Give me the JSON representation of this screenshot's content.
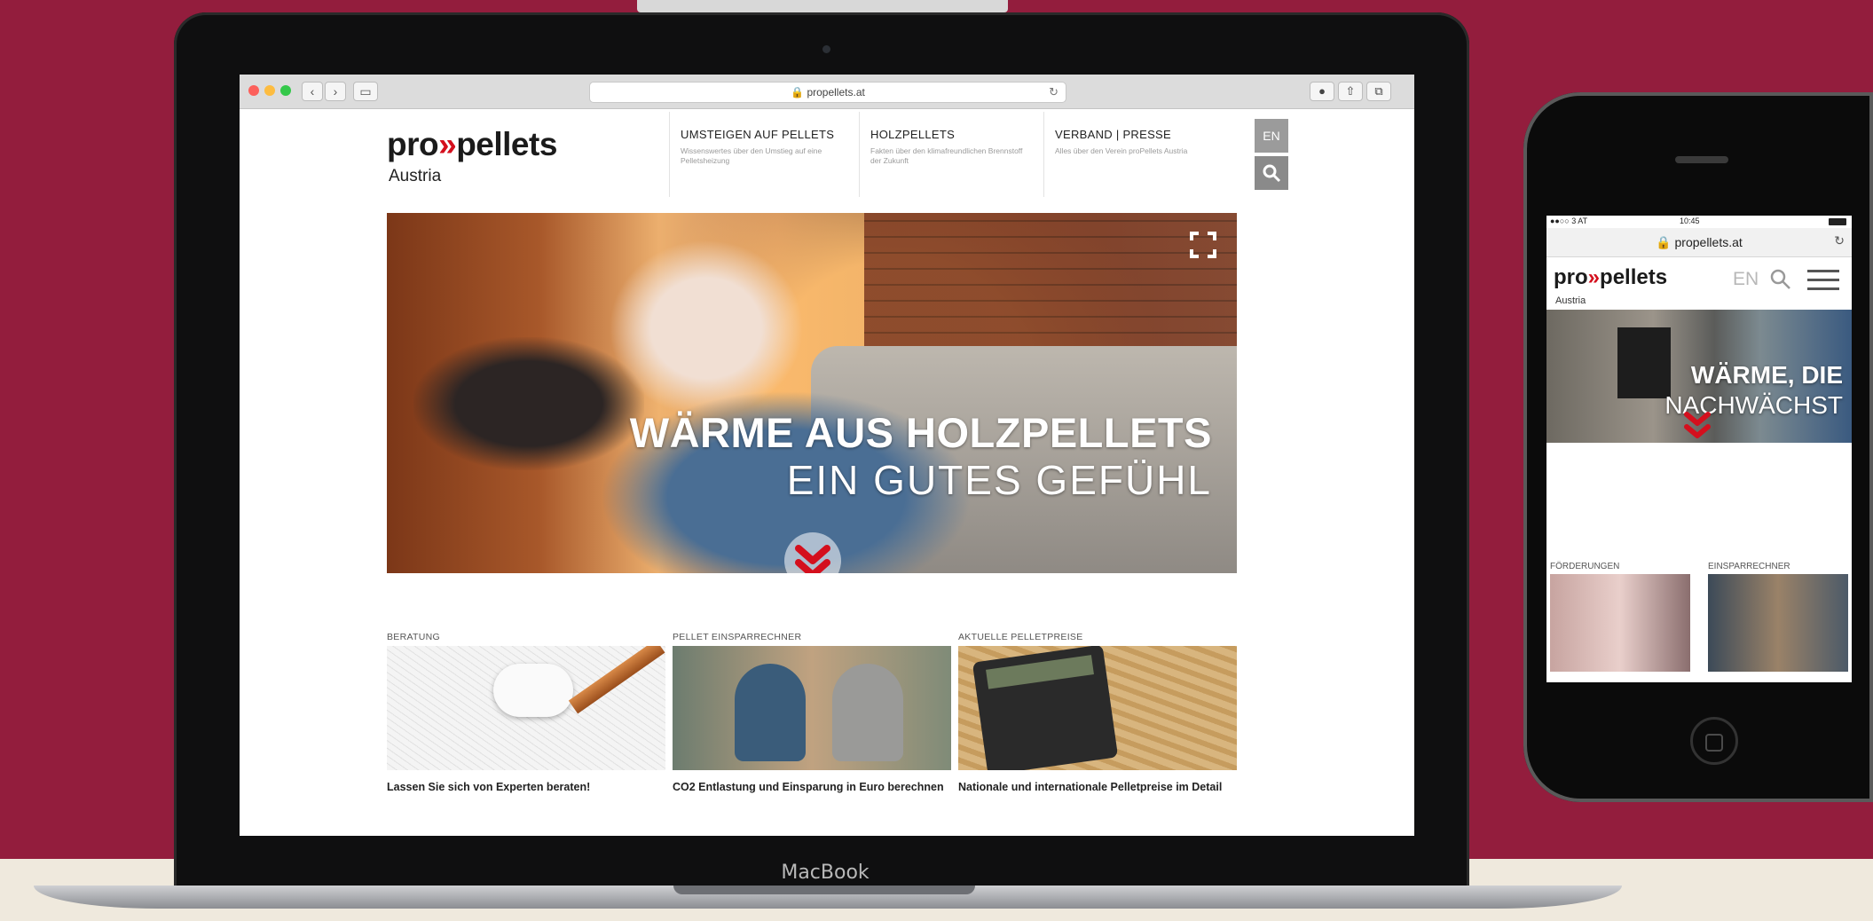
{
  "desktop": {
    "device_label": "MacBook",
    "browser": {
      "url": "propellets.at",
      "reload_icon": "reload-icon",
      "back_icon": "chevron-left-icon",
      "forward_icon": "chevron-right-icon",
      "sidebar_icon": "sidebar-icon"
    },
    "site": {
      "logo_left": "pro",
      "logo_mark": "»",
      "logo_right": "pellets",
      "logo_sub": "Austria",
      "nav": [
        {
          "title": "UMSTEIGEN AUF PELLETS",
          "desc": "Wissenswertes über den Umstieg auf eine Pelletsheizung"
        },
        {
          "title": "HOLZPELLETS",
          "desc": "Fakten über den klimafreundlichen Brennstoff der Zukunft"
        },
        {
          "title": "VERBAND | PRESSE",
          "desc": "Alles über den Verein proPellets Austria"
        }
      ],
      "lang": "EN",
      "hero_line1": "WÄRME AUS HOLZPELLETS",
      "hero_line2": "EIN GUTES GEFÜHL",
      "cards": [
        {
          "label": "BERATUNG",
          "caption": "Lassen Sie sich von Experten beraten!"
        },
        {
          "label": "PELLET EINSPARRECHNER",
          "caption": "CO2 Entlastung und Einsparung in Euro berechnen"
        },
        {
          "label": "AKTUELLE PELLETPREISE",
          "caption": "Nationale und internationale Pelletpreise im Detail"
        }
      ]
    }
  },
  "mobile": {
    "status_left": "●●○○ 3 AT",
    "status_time": "10:45",
    "url": "propellets.at",
    "logo_left": "pro",
    "logo_mark": "»",
    "logo_right": "pellets",
    "lang": "EN",
    "logo_sub": "Austria",
    "hero_line1": "WÄRME, DIE",
    "hero_line2": "NACHWÄCHST",
    "cards": [
      {
        "label": "FÖRDERUNGEN"
      },
      {
        "label": "EINSPARRECHNER"
      }
    ]
  },
  "colors": {
    "background": "#931d3d",
    "accent_red": "#d40f1d"
  }
}
